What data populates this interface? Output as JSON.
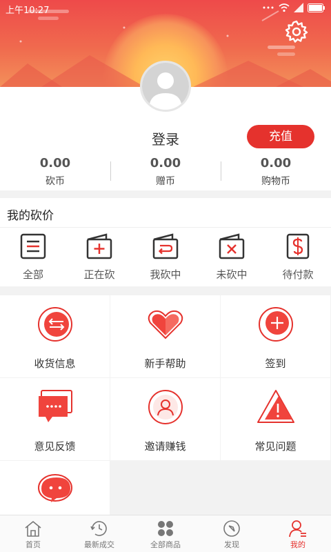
{
  "status_bar": {
    "time": "上午10:27"
  },
  "header": {
    "login_label": "登录",
    "recharge_label": "充值"
  },
  "stats": [
    {
      "value": "0.00",
      "label": "砍币"
    },
    {
      "value": "0.00",
      "label": "赠币"
    },
    {
      "value": "0.00",
      "label": "购物币"
    }
  ],
  "my_bargain": {
    "title": "我的砍价",
    "items": [
      {
        "label": "全部",
        "icon": "list-icon"
      },
      {
        "label": "正在砍",
        "icon": "plus-wallet-icon"
      },
      {
        "label": "我砍中",
        "icon": "return-wallet-icon"
      },
      {
        "label": "未砍中",
        "icon": "cross-wallet-icon"
      },
      {
        "label": "待付款",
        "icon": "dollar-icon"
      }
    ]
  },
  "services": [
    {
      "label": "收货信息",
      "icon": "exchange-icon"
    },
    {
      "label": "新手帮助",
      "icon": "heart-tag-icon"
    },
    {
      "label": "签到",
      "icon": "plus-circle-icon"
    },
    {
      "label": "意见反馈",
      "icon": "chat-bubble-icon"
    },
    {
      "label": "邀请赚钱",
      "icon": "user-circle-icon"
    },
    {
      "label": "常见问题",
      "icon": "warning-icon"
    },
    {
      "label": "",
      "icon": "message-icon"
    }
  ],
  "tabbar": [
    {
      "label": "首页",
      "icon": "home-icon"
    },
    {
      "label": "最新成交",
      "icon": "clock-icon"
    },
    {
      "label": "全部商品",
      "icon": "grid-icon"
    },
    {
      "label": "发现",
      "icon": "compass-icon"
    },
    {
      "label": "我的",
      "icon": "user-icon",
      "active": true
    }
  ],
  "colors": {
    "accent": "#e5322d",
    "header_top": "#ee4a4a",
    "header_bottom": "#f3905a"
  }
}
